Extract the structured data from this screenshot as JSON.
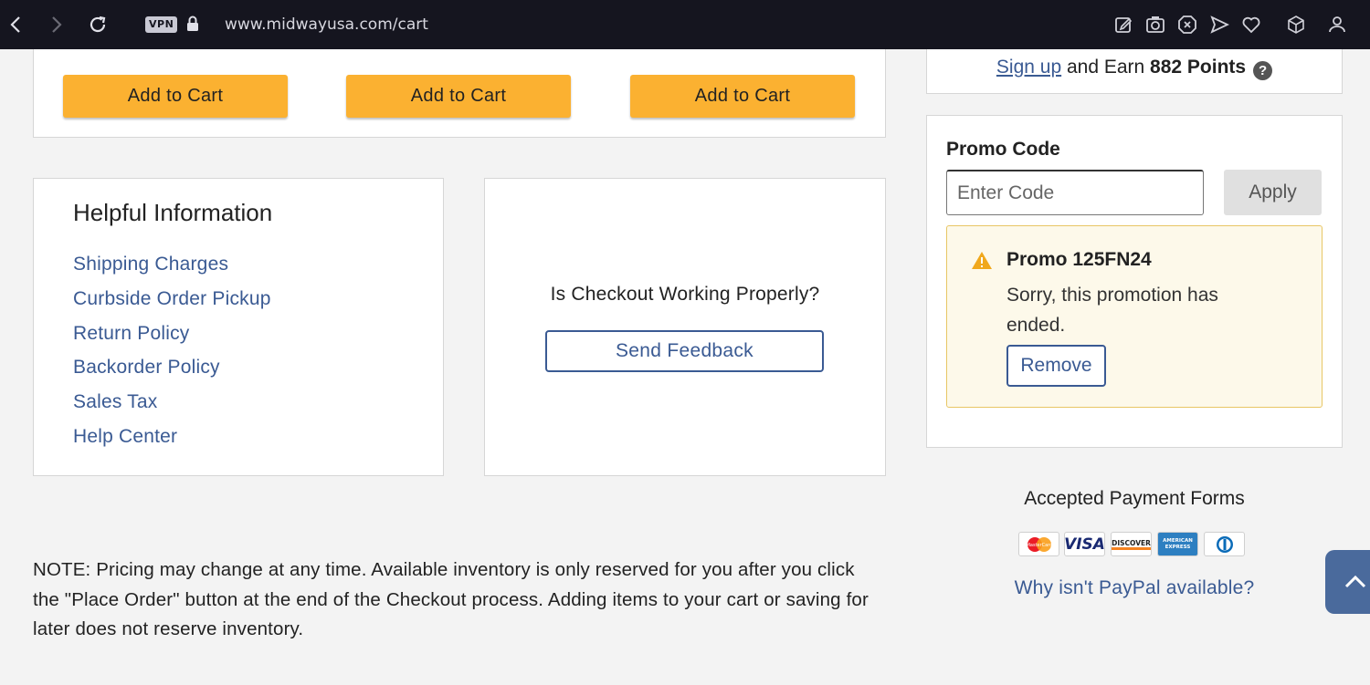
{
  "browser": {
    "vpn_label": "VPN",
    "url": "www.midwayusa.com/cart"
  },
  "recommendations": {
    "buttons": [
      "Add to Cart",
      "Add to Cart",
      "Add to Cart"
    ]
  },
  "helpful_info": {
    "title": "Helpful Information",
    "links": [
      "Shipping Charges",
      "Curbside Order Pickup",
      "Return Policy",
      "Backorder Policy",
      "Sales Tax",
      "Help Center"
    ]
  },
  "feedback": {
    "question": "Is Checkout Working Properly?",
    "button": "Send Feedback"
  },
  "note": "NOTE: Pricing may change at any time. Available inventory is only reserved for you after you click the \"Place Order\" button at the end of the Checkout process. Adding items to your cart or saving for later does not reserve inventory.",
  "rewards": {
    "signup_link": "Sign up",
    "earn_text": " and Earn ",
    "points": "882 Points",
    "help_icon": "?"
  },
  "promo": {
    "label": "Promo Code",
    "placeholder": "Enter Code",
    "value": "",
    "apply_button": "Apply",
    "alert": {
      "icon": "warning-icon",
      "title": "Promo 125FN24",
      "message": "Sorry, this promotion has ended.",
      "remove_button": "Remove"
    }
  },
  "payment": {
    "title": "Accepted Payment Forms",
    "cards": [
      "MasterCard",
      "VISA",
      "DISCOVER",
      "AMERICAN EXPRESS",
      "Diners Club"
    ],
    "paypal_link": "Why isn't PayPal available?"
  },
  "colors": {
    "accent_orange": "#fbb131",
    "link_blue": "#3a5a93",
    "alert_bg": "#fdf9ea",
    "alert_border": "#e8c665",
    "browser_bar": "#15151f"
  }
}
